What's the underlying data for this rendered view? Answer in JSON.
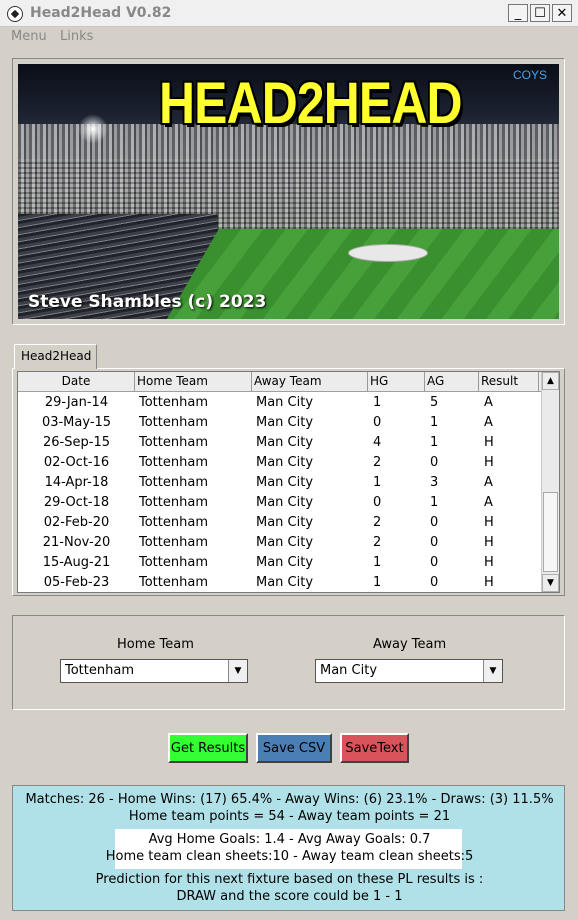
{
  "window": {
    "title": "Head2Head V0.82",
    "buttons": [
      "_",
      "☐",
      "✕"
    ]
  },
  "menu": {
    "items": [
      "Menu",
      "Links"
    ]
  },
  "banner": {
    "title": "HEAD2HEAD",
    "corner_text": "COYS",
    "credit": "Steve Shambles (c) 2023"
  },
  "tab": {
    "label": "Head2Head"
  },
  "table": {
    "columns": [
      "Date",
      "Home Team",
      "Away Team",
      "HG",
      "AG",
      "Result"
    ],
    "rows": [
      [
        "29-Jan-14",
        "Tottenham",
        "Man City",
        "1",
        "5",
        "A"
      ],
      [
        "03-May-15",
        "Tottenham",
        "Man City",
        "0",
        "1",
        "A"
      ],
      [
        "26-Sep-15",
        "Tottenham",
        "Man City",
        "4",
        "1",
        "H"
      ],
      [
        "02-Oct-16",
        "Tottenham",
        "Man City",
        "2",
        "0",
        "H"
      ],
      [
        "14-Apr-18",
        "Tottenham",
        "Man City",
        "1",
        "3",
        "A"
      ],
      [
        "29-Oct-18",
        "Tottenham",
        "Man City",
        "0",
        "1",
        "A"
      ],
      [
        "02-Feb-20",
        "Tottenham",
        "Man City",
        "2",
        "0",
        "H"
      ],
      [
        "21-Nov-20",
        "Tottenham",
        "Man City",
        "2",
        "0",
        "H"
      ],
      [
        "15-Aug-21",
        "Tottenham",
        "Man City",
        "1",
        "0",
        "H"
      ],
      [
        "05-Feb-23",
        "Tottenham",
        "Man City",
        "1",
        "0",
        "H"
      ]
    ]
  },
  "selection": {
    "home_label": "Home Team",
    "away_label": "Away Team",
    "home_value": "Tottenham",
    "away_value": "Man City"
  },
  "buttons": {
    "get_results": "Get Results",
    "save_csv": "Save  CSV",
    "save_text": "SaveText",
    "colors": {
      "get_results": "#33ff33",
      "save_csv": "#4a7fb5",
      "save_text": "#d9535a"
    }
  },
  "results": {
    "summary": "Matches: 26  -  Home Wins: (17) 65.4%  -  Away Wins: (6) 23.1%  -  Draws: (3) 11.5%",
    "points": "Home team points = 54 - Away team points = 21",
    "avg_goals": "Avg Home Goals: 1.4 - Avg Away Goals: 0.7",
    "clean_sheets": "Home team clean sheets:10 - Away team clean sheets:5",
    "prediction_1": "Prediction for this next fixture based on these PL results is :",
    "prediction_2": "DRAW and the score could be 1 - 1"
  }
}
